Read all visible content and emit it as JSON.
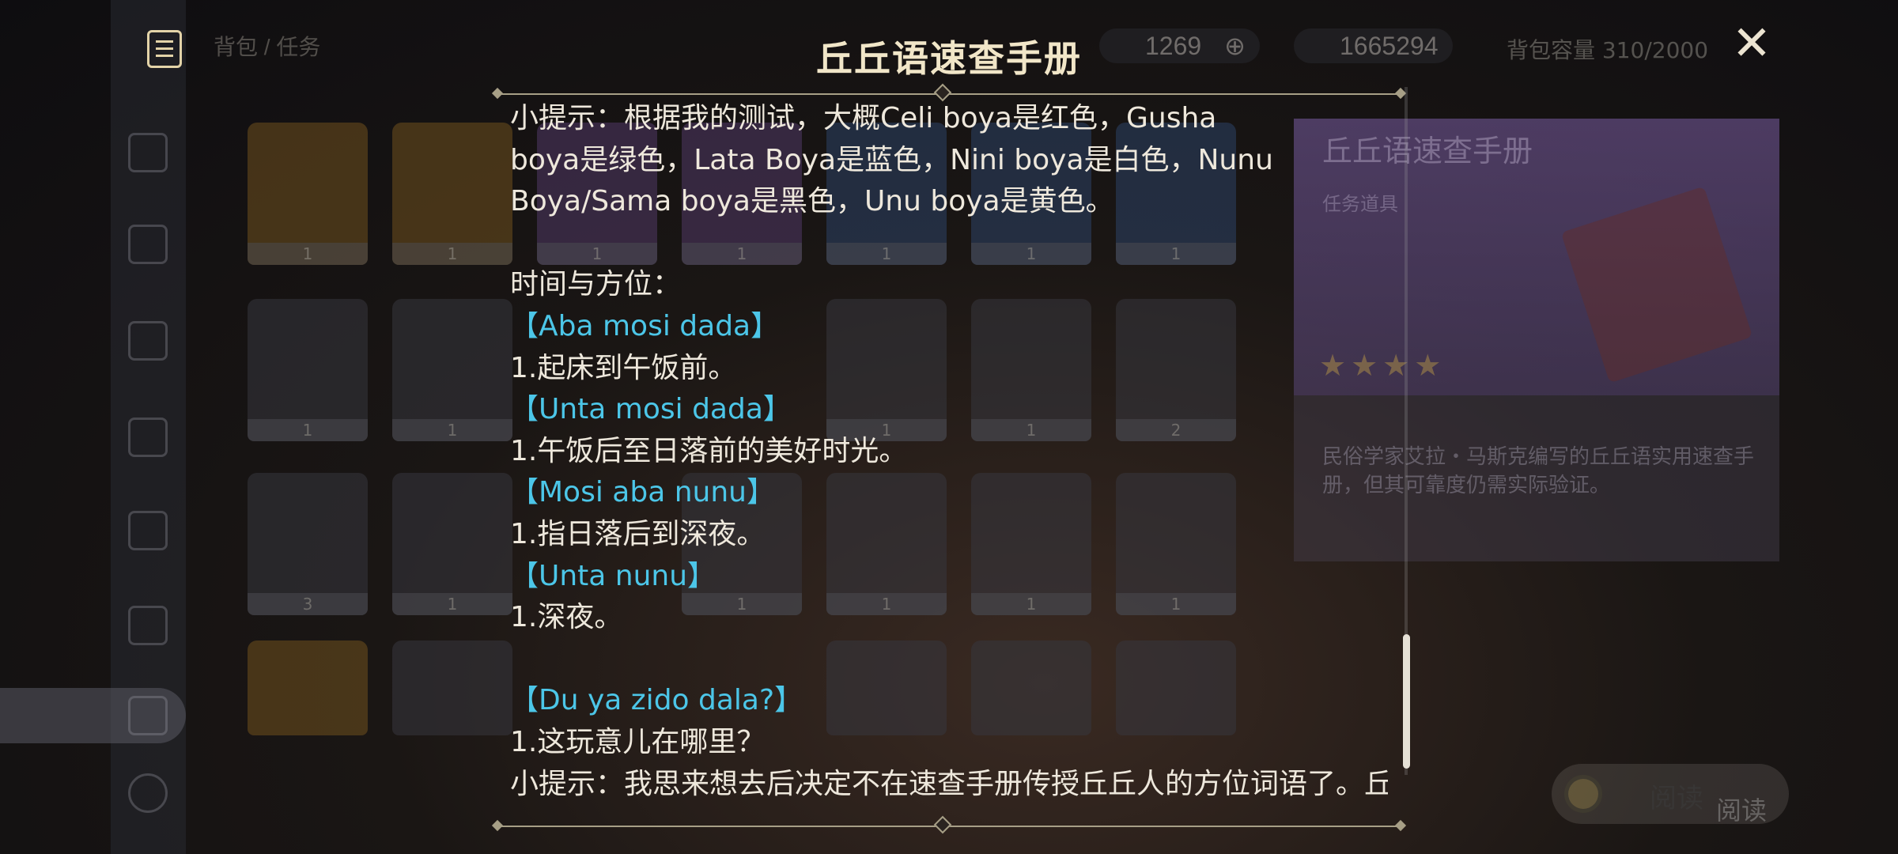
{
  "background": {
    "breadcrumb": "背包 / 任务",
    "primogems": "1269",
    "mora": "1665294",
    "capacity": "背包容量 310/2000",
    "grid_counts": [
      [
        "1",
        "1",
        "1",
        "1",
        "1",
        "1",
        "1"
      ],
      [
        "1",
        "1",
        "",
        "1",
        "1",
        "2",
        ""
      ],
      [
        "3",
        "1",
        "1",
        "1",
        "1",
        "1",
        ""
      ],
      [
        "",
        "",
        "",
        "",
        "",
        "",
        ""
      ]
    ],
    "detail": {
      "title": "丘丘语速查手册",
      "type": "任务道具",
      "stars": "★★★★",
      "description": "民俗学家艾拉・马斯克编写的丘丘语实用速查手册，但其可靠度仍需实际验证。"
    },
    "read_button_label": "阅读",
    "read_ghost": "阅读"
  },
  "modal": {
    "title": "丘丘语速查手册",
    "close_glyph": "✕",
    "lines": [
      {
        "text": "小提示：根据我的测试，大概Celi boya是红色，Gusha",
        "type": "text"
      },
      {
        "text": "boya是绿色，Lata Boya是蓝色，Nini boya是白色，Nunu",
        "type": "text"
      },
      {
        "text": "Boya/Sama boya是黑色，Unu boya是黄色。",
        "type": "text"
      },
      {
        "text": "",
        "type": "blank"
      },
      {
        "text": "时间与方位：",
        "type": "text"
      },
      {
        "text": "【Aba mosi dada】",
        "type": "heading"
      },
      {
        "text": "1.起床到午饭前。",
        "type": "text"
      },
      {
        "text": "【Unta mosi dada】",
        "type": "heading"
      },
      {
        "text": "1.午饭后至日落前的美好时光。",
        "type": "text"
      },
      {
        "text": "【Mosi aba nunu】",
        "type": "heading"
      },
      {
        "text": "1.指日落后到深夜。",
        "type": "text"
      },
      {
        "text": "【Unta nunu】",
        "type": "heading"
      },
      {
        "text": "1.深夜。",
        "type": "text"
      },
      {
        "text": "",
        "type": "blank"
      },
      {
        "text": "【Du ya zido dala?】",
        "type": "heading"
      },
      {
        "text": "1.这玩意儿在哪里？",
        "type": "text"
      },
      {
        "text": "小提示：我思来想去后决定不在速查手册传授丘丘人的方位词语了。丘",
        "type": "text"
      }
    ]
  },
  "colors": {
    "heading": "#4cc6e8",
    "body_text": "#eee8dc",
    "title": "#f1e6c8"
  },
  "icons": [
    "menu-icon",
    "close-icon",
    "primogem-icon",
    "mora-icon",
    "plus-icon",
    "read-icon"
  ]
}
